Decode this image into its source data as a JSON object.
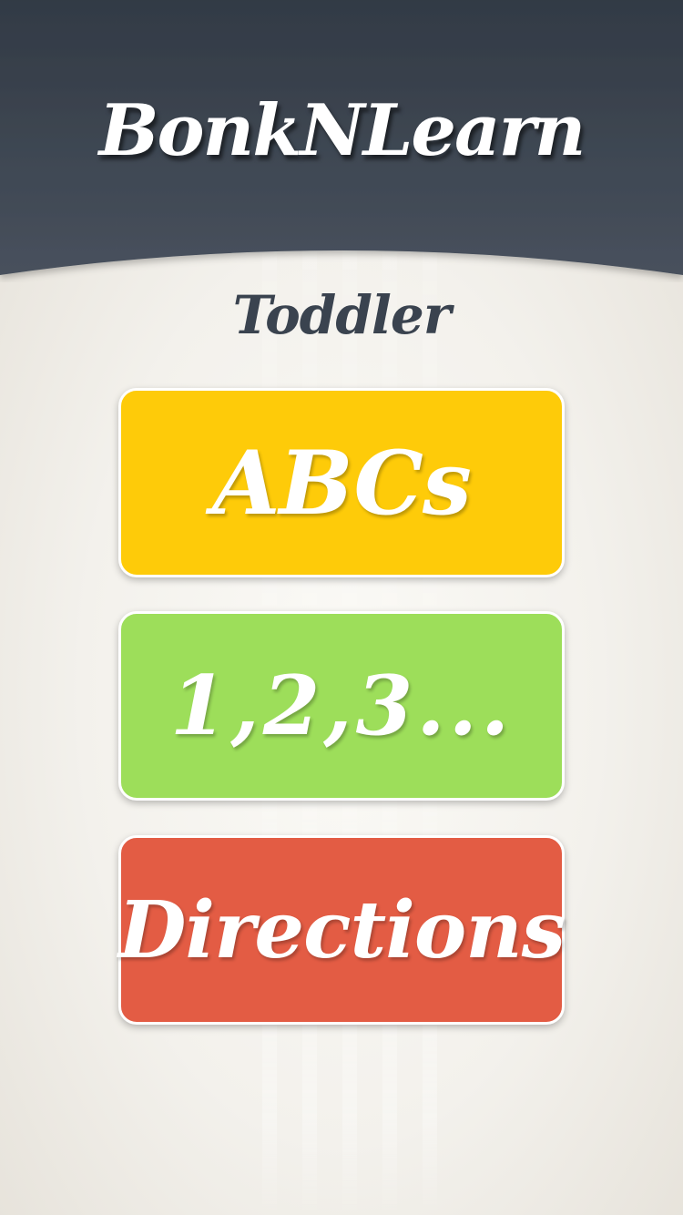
{
  "app": {
    "title": "BonkNLearn"
  },
  "screen": {
    "subtitle": "Toddler"
  },
  "menu": {
    "items": [
      {
        "label": "ABCs",
        "color": "#fecb09"
      },
      {
        "label": "1,2,3...",
        "color": "#9dde5a"
      },
      {
        "label": "Directions",
        "color": "#e35c44"
      }
    ]
  },
  "colors": {
    "header_top": "#333b46",
    "header_bottom": "#454e5a",
    "subtitle": "#3a434f",
    "background": "#f0eee8"
  }
}
